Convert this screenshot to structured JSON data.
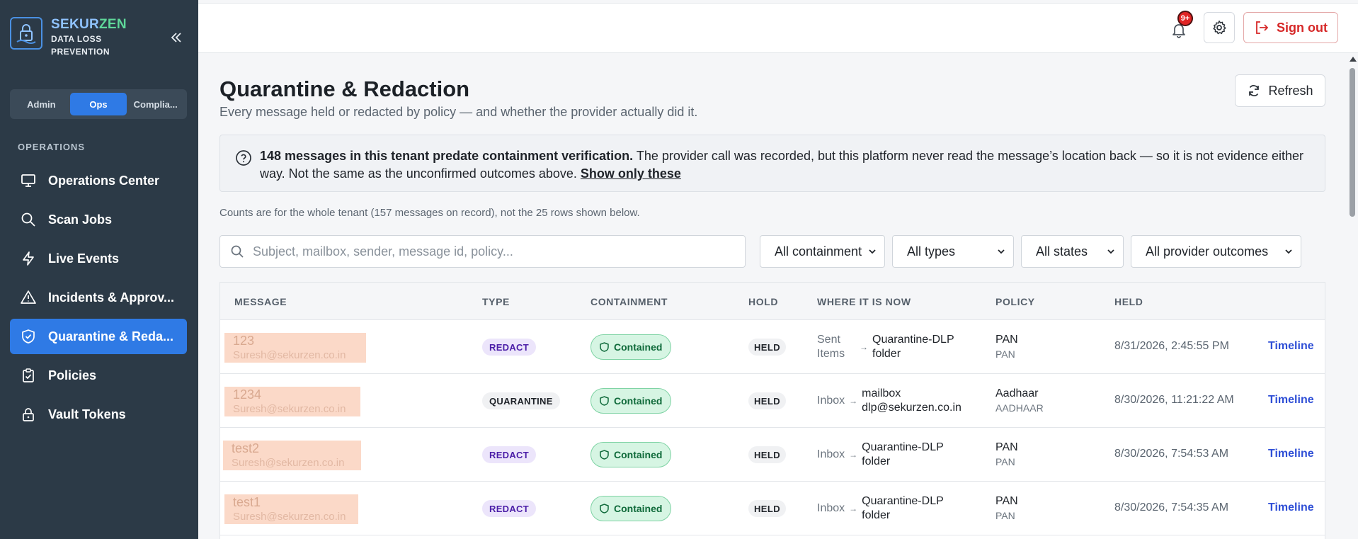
{
  "brand": {
    "name_part1": "SEKUR",
    "name_part2": "ZEN",
    "sub_line1": "DATA LOSS",
    "sub_line2": "PREVENTION"
  },
  "roles": [
    {
      "label": "Admin",
      "active": false
    },
    {
      "label": "Ops",
      "active": true
    },
    {
      "label": "Complia...",
      "active": false
    }
  ],
  "sidebar": {
    "section_label": "OPERATIONS",
    "items": [
      {
        "label": "Operations Center",
        "icon": "monitor-icon",
        "active": false
      },
      {
        "label": "Scan Jobs",
        "icon": "search-icon",
        "active": false
      },
      {
        "label": "Live Events",
        "icon": "lightning-icon",
        "active": false
      },
      {
        "label": "Incidents & Approv...",
        "icon": "warning-icon",
        "active": false
      },
      {
        "label": "Quarantine & Reda...",
        "icon": "shield-check-icon",
        "active": true
      },
      {
        "label": "Policies",
        "icon": "clipboard-check-icon",
        "active": false
      },
      {
        "label": "Vault Tokens",
        "icon": "lock-icon",
        "active": false
      }
    ]
  },
  "topbar": {
    "notification_badge": "9+",
    "signout_label": "Sign out"
  },
  "page": {
    "title": "Quarantine & Redaction",
    "subtitle": "Every message held or redacted by policy — and whether the provider actually did it.",
    "refresh_label": "Refresh"
  },
  "notice": {
    "bold": "148 messages in this tenant predate containment verification.",
    "text": " The provider call was recorded, but this platform never read the message’s location back — so it is not evidence either way. Not the same as the unconfirmed outcomes above. ",
    "link": "Show only these"
  },
  "counts_text": "Counts are for the whole tenant (157 messages on record), not the 25 rows shown below.",
  "filters": {
    "search_placeholder": "Subject, mailbox, sender, message id, policy...",
    "containment": "All containment",
    "types": "All types",
    "states": "All states",
    "provider": "All provider outcomes"
  },
  "table": {
    "headers": [
      "MESSAGE",
      "TYPE",
      "CONTAINMENT",
      "HOLD",
      "WHERE IT IS NOW",
      "POLICY",
      "HELD"
    ],
    "rows": [
      {
        "subject": "123",
        "from": "Suresh@sekurzen.co.in",
        "type": "REDACT",
        "containment": "Contained",
        "hold": "HELD",
        "where_from": "Sent Items",
        "where_to": "Quarantine-DLP folder",
        "policy": "PAN",
        "policy_sub": "PAN",
        "held": "8/31/2026, 2:45:55 PM",
        "action": "Timeline"
      },
      {
        "subject": "1234",
        "from": "Suresh@sekurzen.co.in",
        "type": "QUARANTINE",
        "containment": "Contained",
        "hold": "HELD",
        "where_from": "Inbox",
        "where_to": "mailbox dlp@sekurzen.co.in",
        "policy": "Aadhaar",
        "policy_sub": "AADHAAR",
        "held": "8/30/2026, 11:21:22 AM",
        "action": "Timeline"
      },
      {
        "subject": "test2",
        "from": "Suresh@sekurzen.co.in",
        "type": "REDACT",
        "containment": "Contained",
        "hold": "HELD",
        "where_from": "Inbox",
        "where_to": "Quarantine-DLP folder",
        "policy": "PAN",
        "policy_sub": "PAN",
        "held": "8/30/2026, 7:54:53 AM",
        "action": "Timeline"
      },
      {
        "subject": "test1",
        "from": "Suresh@sekurzen.co.in",
        "type": "REDACT",
        "containment": "Contained",
        "hold": "HELD",
        "where_from": "Inbox",
        "where_to": "Quarantine-DLP folder",
        "policy": "PAN",
        "policy_sub": "PAN",
        "held": "8/30/2026, 7:54:35 AM",
        "action": "Timeline"
      }
    ]
  }
}
